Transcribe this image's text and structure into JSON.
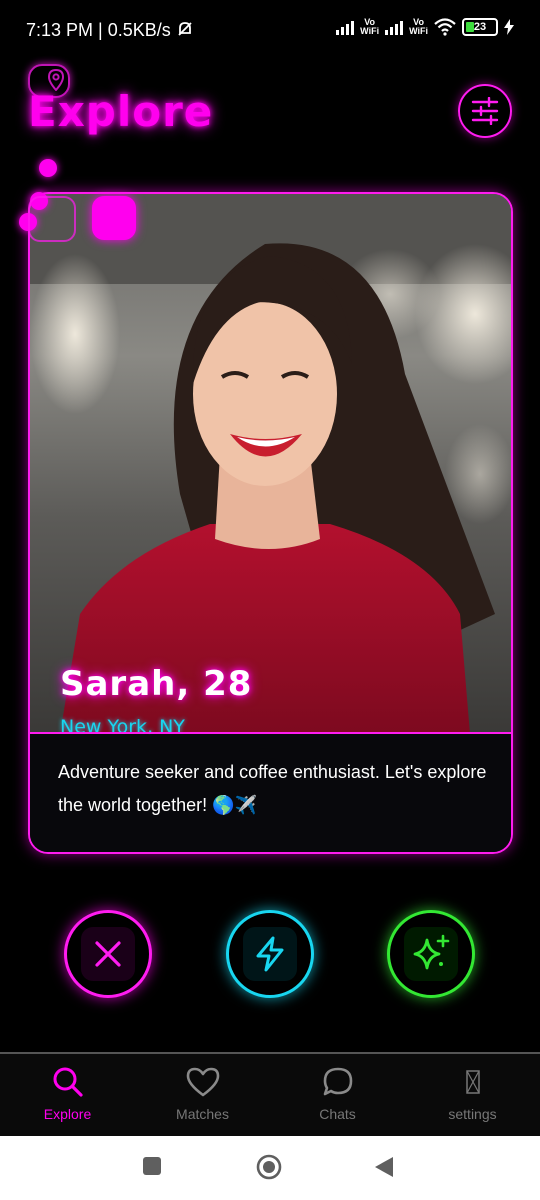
{
  "status_bar": {
    "time_speed": "7:13 PM | 0.5KB/s",
    "vowifi_1": "Vo\nWiFi",
    "vowifi_2": "Vo\nWiFi",
    "battery": "23"
  },
  "header": {
    "title": "Explore"
  },
  "profile": {
    "name": "Sarah, 28",
    "location": "New York, NY",
    "bio": "Adventure seeker and coffee enthusiast. Let's explore the world together! 🌎✈️"
  },
  "nav": {
    "items": [
      {
        "label": "Explore",
        "icon": "search-icon",
        "active": true
      },
      {
        "label": "Matches",
        "icon": "heart-icon",
        "active": false
      },
      {
        "label": "Chats",
        "icon": "chat-bubble-icon",
        "active": false
      },
      {
        "label": "settings",
        "icon": "missing-glyph-icon",
        "active": false
      }
    ]
  },
  "colors": {
    "accent": "#ff00ee",
    "cyan": "#18d6f0",
    "green": "#33e833"
  }
}
